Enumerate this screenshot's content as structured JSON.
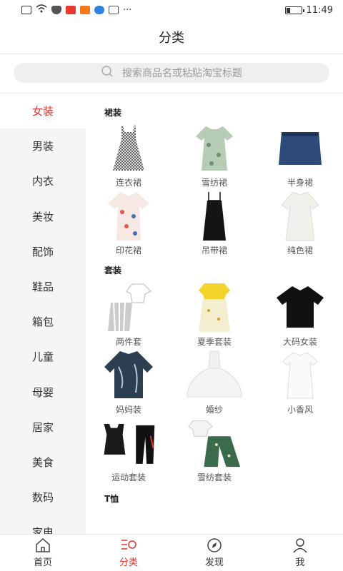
{
  "status": {
    "time": "11:49",
    "more": "···"
  },
  "header": {
    "title": "分类"
  },
  "search": {
    "placeholder": "搜索商品名或粘贴淘宝标题"
  },
  "sidebar": {
    "items": [
      {
        "label": "女装"
      },
      {
        "label": "男装"
      },
      {
        "label": "内衣"
      },
      {
        "label": "美妆"
      },
      {
        "label": "配饰"
      },
      {
        "label": "鞋品"
      },
      {
        "label": "箱包"
      },
      {
        "label": "儿童"
      },
      {
        "label": "母婴"
      },
      {
        "label": "居家"
      },
      {
        "label": "美食"
      },
      {
        "label": "数码"
      },
      {
        "label": "家电"
      }
    ]
  },
  "sections": [
    {
      "title": "裙装",
      "items": [
        {
          "label": "连衣裙"
        },
        {
          "label": "雪纺裙"
        },
        {
          "label": "半身裙"
        },
        {
          "label": "印花裙"
        },
        {
          "label": "吊带裙"
        },
        {
          "label": "纯色裙"
        }
      ]
    },
    {
      "title": "套装",
      "items": [
        {
          "label": "两件套"
        },
        {
          "label": "夏季套装"
        },
        {
          "label": "大码女装"
        },
        {
          "label": "妈妈装"
        },
        {
          "label": "婚纱"
        },
        {
          "label": "小香风"
        },
        {
          "label": "运动套装"
        },
        {
          "label": "雪纺套装"
        }
      ]
    },
    {
      "title": "T恤"
    }
  ],
  "tabs": [
    {
      "label": "首页"
    },
    {
      "label": "分类"
    },
    {
      "label": "发现"
    },
    {
      "label": "我"
    }
  ],
  "colors": {
    "accent": "#e5322d"
  }
}
